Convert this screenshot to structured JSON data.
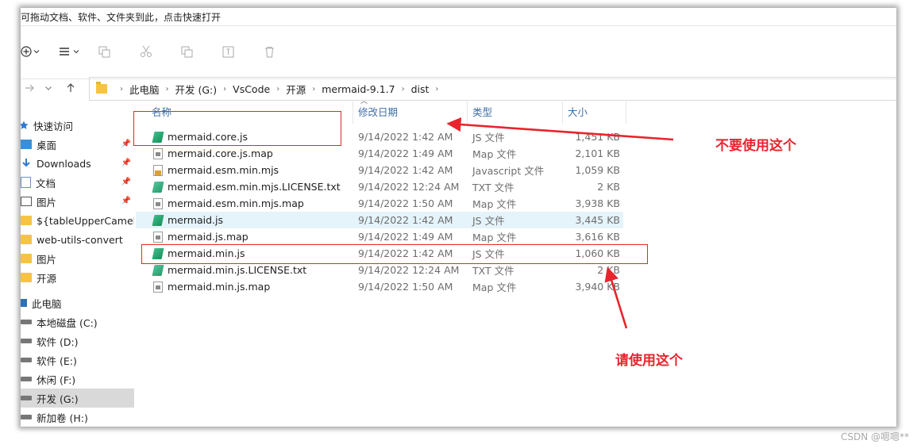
{
  "hint_text": "可拖动文档、软件、文件夹到此，点击快速打开",
  "address": {
    "crumbs": [
      "此电脑",
      "开发 (G:)",
      "VsCode",
      "开源",
      "mermaid-9.1.7",
      "dist"
    ]
  },
  "toolbar": {
    "new_icon": "plus-circle-icon",
    "view_icon": "list-icon"
  },
  "sidebar": {
    "items": [
      {
        "label": "快速访问",
        "icon": "star-icon"
      },
      {
        "label": "桌面",
        "icon": "desktop-icon",
        "pinned": true
      },
      {
        "label": "Downloads",
        "icon": "download-icon",
        "pinned": true
      },
      {
        "label": "文档",
        "icon": "document-icon",
        "pinned": true
      },
      {
        "label": "图片",
        "icon": "picture-icon",
        "pinned": true
      },
      {
        "label": "${tableUpperCamelCa",
        "icon": "folder-icon"
      },
      {
        "label": "web-utils-convert",
        "icon": "folder-icon"
      },
      {
        "label": "图片",
        "icon": "folder-icon"
      },
      {
        "label": "开源",
        "icon": "folder-icon"
      },
      {
        "label": "此电脑",
        "icon": "computer-icon"
      },
      {
        "label": "本地磁盘 (C:)",
        "icon": "drive-icon"
      },
      {
        "label": "软件 (D:)",
        "icon": "drive-icon"
      },
      {
        "label": "软件 (E:)",
        "icon": "drive-icon"
      },
      {
        "label": "休闲 (F:)",
        "icon": "drive-icon"
      },
      {
        "label": "开发 (G:)",
        "icon": "drive-icon",
        "selected": true
      },
      {
        "label": "新加卷 (H:)",
        "icon": "drive-icon"
      }
    ]
  },
  "columns": {
    "name": "名称",
    "date": "修改日期",
    "type": "类型",
    "size": "大小"
  },
  "files": [
    {
      "name": "mermaid.core.js",
      "date": "9/14/2022 1:42 AM",
      "type": "JS 文件",
      "size": "1,451 KB",
      "icon": "js"
    },
    {
      "name": "mermaid.core.js.map",
      "date": "9/14/2022 1:49 AM",
      "type": "Map 文件",
      "size": "2,101 KB",
      "icon": "map"
    },
    {
      "name": "mermaid.esm.min.mjs",
      "date": "9/14/2022 1:42 AM",
      "type": "Javascript 文件",
      "size": "1,059 KB",
      "icon": "mjs"
    },
    {
      "name": "mermaid.esm.min.mjs.LICENSE.txt",
      "date": "9/14/2022 12:24 AM",
      "type": "TXT 文件",
      "size": "2 KB",
      "icon": "txt"
    },
    {
      "name": "mermaid.esm.min.mjs.map",
      "date": "9/14/2022 1:50 AM",
      "type": "Map 文件",
      "size": "3,938 KB",
      "icon": "map"
    },
    {
      "name": "mermaid.js",
      "date": "9/14/2022 1:42 AM",
      "type": "JS 文件",
      "size": "3,445 KB",
      "icon": "js"
    },
    {
      "name": "mermaid.js.map",
      "date": "9/14/2022 1:49 AM",
      "type": "Map 文件",
      "size": "3,616 KB",
      "icon": "map"
    },
    {
      "name": "mermaid.min.js",
      "date": "9/14/2022 1:42 AM",
      "type": "JS 文件",
      "size": "1,060 KB",
      "icon": "js"
    },
    {
      "name": "mermaid.min.js.LICENSE.txt",
      "date": "9/14/2022 12:24 AM",
      "type": "TXT 文件",
      "size": "2 KB",
      "icon": "txt"
    },
    {
      "name": "mermaid.min.js.map",
      "date": "9/14/2022 1:50 AM",
      "type": "Map 文件",
      "size": "3,940 KB",
      "icon": "map"
    }
  ],
  "annotations": {
    "dont_use": "不要使用这个",
    "use_this": "请使用这个",
    "color": "#e8242c"
  },
  "watermark": "CSDN @嗯嗯**"
}
